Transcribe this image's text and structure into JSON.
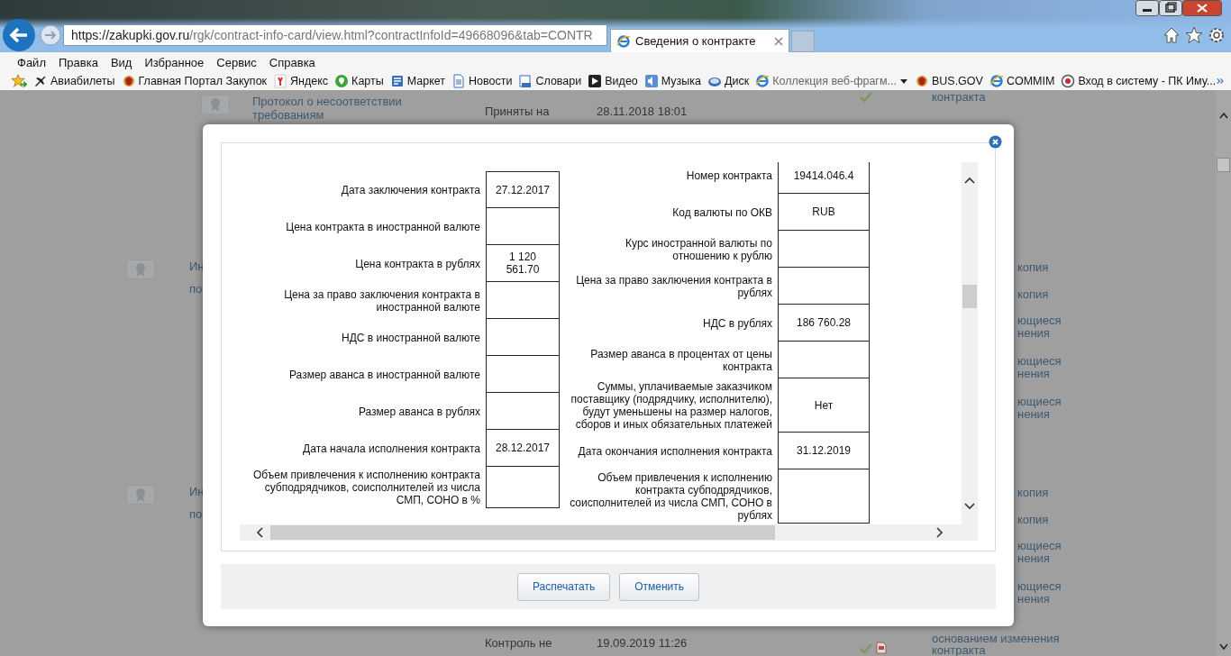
{
  "browser": {
    "address": {
      "host": "https://zakupki.gov.ru",
      "path": "/rgk/contract-info-card/view.html?contractInfoId=49668096&tab=CONTR"
    },
    "tabs": [
      {
        "title": "Сведения о контракте",
        "selected": true
      }
    ],
    "menu": [
      "Файл",
      "Правка",
      "Вид",
      "Избранное",
      "Сервис",
      "Справка"
    ],
    "favorites": [
      {
        "label": "Авиабилеты"
      },
      {
        "label": "Главная Портал Закупок"
      },
      {
        "label": "Яндекс"
      },
      {
        "label": "Карты"
      },
      {
        "label": "Маркет"
      },
      {
        "label": "Новости"
      },
      {
        "label": "Словари"
      },
      {
        "label": "Видео"
      },
      {
        "label": "Музыка"
      },
      {
        "label": "Диск"
      },
      {
        "label": "Коллекция веб-фрагм...",
        "dropdown": true
      },
      {
        "label": "BUS.GOV"
      },
      {
        "label": "COMMIM"
      },
      {
        "label": "Вход в систему - ПК Иму..."
      }
    ]
  },
  "background_page": {
    "top": {
      "document": [
        "Протокол о несоответствии",
        "требованиям"
      ],
      "status": "Приняты на",
      "date": "28.11.2018 18:01",
      "link": "контракта"
    },
    "left_fragments": [
      [
        "Ин",
        "по"
      ],
      [
        "Ин",
        "по"
      ]
    ],
    "right_fragments": [
      [
        [
          "копия"
        ],
        [
          "копия"
        ],
        [
          "ющиеся",
          "нения"
        ],
        [
          "ющиеся",
          "нения"
        ],
        [
          "ющиеся",
          "нения"
        ]
      ],
      [
        [
          "копия"
        ],
        [
          "копия"
        ],
        [
          "ющиеся",
          "нения"
        ],
        [
          "ющиеся",
          "нения"
        ]
      ]
    ],
    "bottom": {
      "status": "Контроль не",
      "date": "19.09.2019 11:26",
      "link": [
        "основанием изменения",
        "контракта"
      ]
    }
  },
  "dialog": {
    "left_table": [
      {
        "label": "Дата заключения контракта",
        "value": "27.12.2017"
      },
      {
        "label": "Цена контракта в иностранной валюте"
      },
      {
        "label": "Цена контракта в рублях",
        "value": "1 120 561.70"
      },
      {
        "label": "Цена за право заключения контракта в иностранной валюте"
      },
      {
        "label": "НДС в иностранной валюте"
      },
      {
        "label": "Размер аванса в иностранной валюте"
      },
      {
        "label": "Размер аванса в рублях"
      },
      {
        "label": "Дата начала исполнения контракта",
        "value": "28.12.2017"
      },
      {
        "label": "Объем привлечения к исполнению контракта субподрядчиков, соисполнителей из числа СМП, СОНО в %"
      }
    ],
    "right_table": [
      {
        "label": "Номер контракта",
        "value": "19414.046.4"
      },
      {
        "label": "Код валюты по ОКВ",
        "value": "RUB"
      },
      {
        "label": "Курс иностранной валюты по отношению к рублю"
      },
      {
        "label": "Цена за право заключения контракта в рублях"
      },
      {
        "label": "НДС в рублях",
        "value": "186 760.28"
      },
      {
        "label": "Размер аванса в процентах от цены контракта"
      },
      {
        "label": "Суммы, уплачиваемые заказчиком поставщику (подрядчику, исполнителю), будут уменьшены на размер налогов, сборов и иных обязательных платежей",
        "value": "Нет"
      },
      {
        "label": "Дата окончания исполнения контракта",
        "value": "31.12.2019"
      },
      {
        "label": "Объем привлечения к исполнению контракта субподрядчиков, соисполнителей из числа СМП, СОНО в рублях"
      }
    ],
    "buttons": [
      "Распечатать",
      "Отменить"
    ]
  }
}
